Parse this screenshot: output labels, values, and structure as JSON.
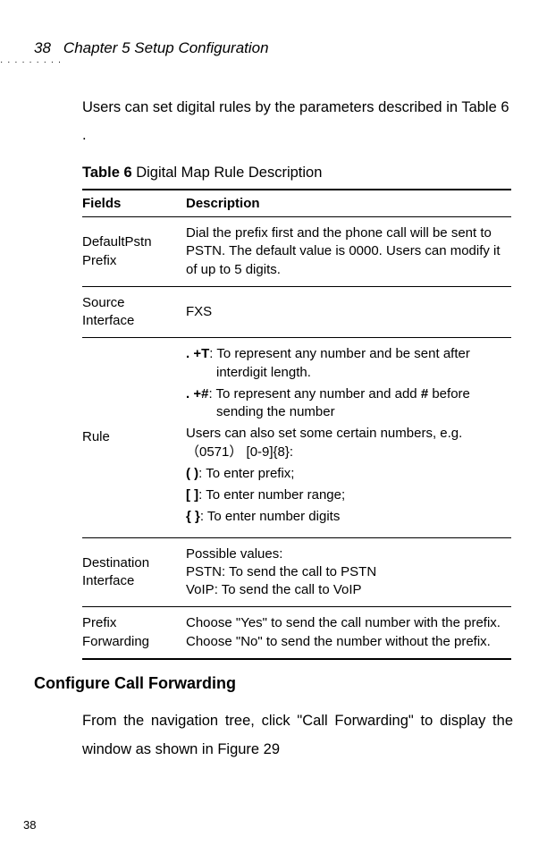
{
  "header": {
    "page_num": "38",
    "chapter": "Chapter 5 Setup Configuration"
  },
  "intro": "Users can set digital rules by the parameters described in Table 6 .",
  "table": {
    "caption_bold": "Table 6",
    "caption_rest": "  Digital Map Rule Description",
    "headers": {
      "fields": "Fields",
      "description": "Description"
    },
    "rows": {
      "r1": {
        "field": "DefaultPstn Prefix",
        "desc": "Dial the prefix first and the phone call will be sent to PSTN. The default value is 0000. Users can modify it of up to 5 digits."
      },
      "r2": {
        "field": "Source Interface",
        "desc": "FXS"
      },
      "r3": {
        "field": "Rule",
        "plusT_label": ". +T",
        "plusT_rest": ": To represent any number and be sent after interdigit length.",
        "plusHash_label": ". +#",
        "plusHash_rest_a": ": To represent any number and add ",
        "plusHash_hash": "#",
        "plusHash_rest_b": " before sending the number",
        "certain": "Users can also set some certain numbers, e.g.（0571） [0-9]{8}:",
        "paren_label": "( )",
        "paren_rest": ": To enter prefix;",
        "bracket_label": "[ ]",
        "bracket_rest": ": To enter number range;",
        "brace_label": "{ }",
        "brace_rest": ": To enter number digits"
      },
      "r4": {
        "field": "Destination Interface",
        "line1": "Possible values:",
        "line2": "PSTN: To send the call to PSTN",
        "line3": "VoIP: To send the call to VoIP"
      },
      "r5": {
        "field": "Prefix Forwarding",
        "desc": "Choose \"Yes\" to send the call number with the prefix. Choose \"No\" to send the number without the prefix."
      }
    }
  },
  "section_heading": "Configure Call Forwarding",
  "section_body": "From the navigation tree, click \"Call Forwarding\" to display the window as shown in Figure 29",
  "footer_page": "38"
}
